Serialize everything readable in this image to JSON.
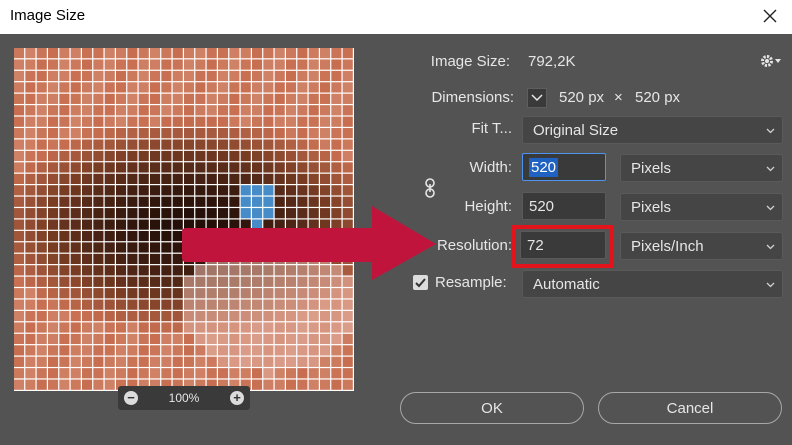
{
  "window": {
    "title": "Image Size"
  },
  "preview": {
    "zoom": "100%"
  },
  "info": {
    "image_size_label": "Image Size:",
    "image_size_value": "792,2K",
    "dimensions_label": "Dimensions:",
    "dim_width": "520 px",
    "dim_sep": "×",
    "dim_height": "520 px"
  },
  "fit": {
    "label": "Fit T...",
    "value": "Original Size"
  },
  "width": {
    "label": "Width:",
    "value": "520",
    "unit": "Pixels"
  },
  "height": {
    "label": "Height:",
    "value": "520",
    "unit": "Pixels"
  },
  "resolution": {
    "label": "Resolution:",
    "value": "72",
    "unit": "Pixels/Inch"
  },
  "resample": {
    "label": "Resample:",
    "value": "Automatic",
    "checked": true
  },
  "buttons": {
    "ok": "OK",
    "cancel": "Cancel"
  },
  "colors": {
    "highlight": "#e3131b",
    "arrow": "#c0143c",
    "selection": "#1f62c2"
  },
  "icons": [
    "close-icon",
    "gear-icon",
    "chevron-down-icon",
    "link-icon",
    "checkmark-icon",
    "zoom-out-icon",
    "zoom-in-icon"
  ]
}
